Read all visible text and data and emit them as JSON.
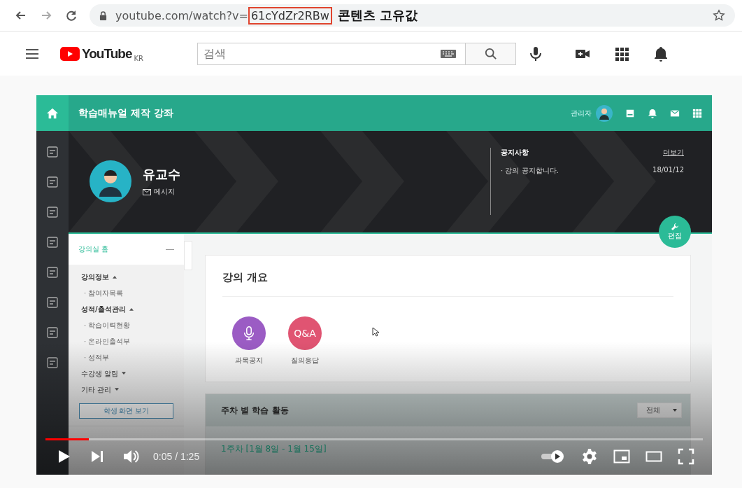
{
  "browser": {
    "url": "youtube.com/watch?v=",
    "video_id": "61cYdZr2RBw",
    "annotation": "콘텐츠 고유값"
  },
  "youtube": {
    "logo": "YouTube",
    "region": "KR",
    "search": {
      "placeholder": "검색"
    }
  },
  "lms": {
    "course_title": "학습매뉴얼 제작 강좌",
    "user_role": "관리자",
    "profile": {
      "name": "유교수",
      "message": "메시지"
    },
    "notice": {
      "title": "공지사항",
      "more": "더보기",
      "items": [
        {
          "text": "· 강의 공지합니다.",
          "date": "18/01/12"
        }
      ]
    },
    "edit_button": "편집",
    "sidebar": {
      "home": "강의실 홈",
      "sections": [
        {
          "label": "강의정보",
          "expanded": true,
          "children": [
            {
              "label": "· 참여자목록"
            }
          ]
        },
        {
          "label": "성적/출석관리",
          "expanded": true,
          "children": [
            {
              "label": "· 학습이력현황"
            },
            {
              "label": "· 온라인출석부"
            },
            {
              "label": "· 성적부"
            }
          ]
        },
        {
          "label": "수강생 알림",
          "expanded": false
        },
        {
          "label": "기타 관리",
          "expanded": false
        }
      ],
      "student_view_button": "학생 화면 보기"
    },
    "overview": {
      "title": "강의 개요",
      "shortcuts": [
        {
          "label": "과목공지",
          "kind": "mic",
          "color": "#9b5cc4"
        },
        {
          "label": "질의응답",
          "kind": "text",
          "badge": "Q&A",
          "color": "#e05472"
        }
      ]
    },
    "weekly": {
      "title": "주차 별 학습 활동",
      "filter": "전체",
      "weeks": [
        {
          "label": "1주차 [1월 8일 - 1월 15일]"
        }
      ]
    }
  },
  "player": {
    "playing": false,
    "progress": {
      "level": 0.066
    },
    "time": "0:05 / 1:25",
    "autoplay": {
      "on": true
    }
  }
}
